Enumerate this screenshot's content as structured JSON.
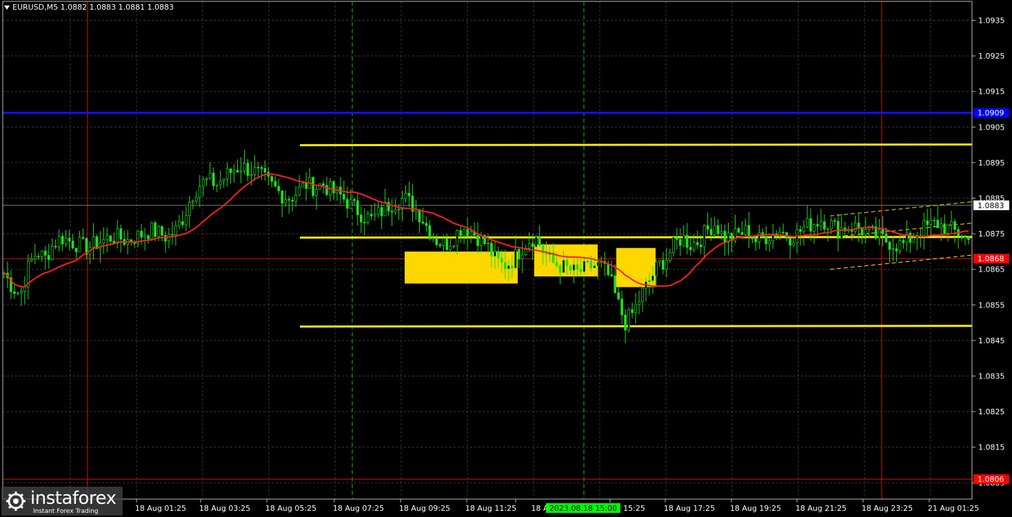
{
  "header": {
    "symbol_info": "EURUSD,M5  1.0882 1.0883 1.0881 1.0883"
  },
  "chart_data": {
    "type": "candlestick",
    "symbol": "EURUSD",
    "timeframe": "M5",
    "ohlc_last": {
      "open": 1.0882,
      "high": 1.0883,
      "low": 1.0881,
      "close": 1.0883
    },
    "ylim": [
      1.0801,
      1.0943
    ],
    "y_ticks": [
      "1.0935",
      "1.0925",
      "1.0915",
      "1.0905",
      "1.0895",
      "1.0885",
      "1.0875",
      "1.0865",
      "1.0855",
      "1.0845",
      "1.0835",
      "1.0825",
      "1.0815",
      "1.0805"
    ],
    "x_ticks": [
      "18 Aug 01:25",
      "18 Aug 03:25",
      "18 Aug 05:25",
      "18 Aug 07:25",
      "18 Aug 09:25",
      "18 Aug 11:25",
      "18 A",
      "15:25",
      "18 Aug 17:25",
      "18 Aug 19:25",
      "18 Aug 21:25",
      "18 Aug 23:25",
      "21 Aug 01:25"
    ],
    "x_highlight_label": "2023.08.18 15:00",
    "price_labels": [
      {
        "text": "1.0909",
        "color": "#0000ff"
      },
      {
        "text": "1.0883",
        "color": "#ffffff"
      },
      {
        "text": "1.0868",
        "color": "#ff0000"
      },
      {
        "text": "1.0806",
        "color": "#ff0000"
      }
    ],
    "levels": {
      "blue_line": 1.0909,
      "red_line_upper": 1.0868,
      "red_line_lower": 1.0806,
      "current_price": 1.0883,
      "yellow_channel": [
        1.09,
        1.0874,
        1.0849
      ]
    },
    "signal_zones": [
      {
        "top": 1.087,
        "bottom": 1.0861
      },
      {
        "top": 1.0872,
        "bottom": 1.0863
      },
      {
        "top": 1.0871,
        "bottom": 1.086
      }
    ],
    "series": [
      {
        "name": "Price",
        "close": [
          1.0864,
          1.086,
          1.0858,
          1.0866,
          1.087,
          1.0868,
          1.0872,
          1.0874,
          1.0873,
          1.0872,
          1.0871,
          1.0872,
          1.0873,
          1.0874,
          1.0874,
          1.0873,
          1.0874,
          1.0875,
          1.0876,
          1.0875,
          1.0874,
          1.0876,
          1.088,
          1.0886,
          1.0889,
          1.089,
          1.0889,
          1.0891,
          1.0893,
          1.0894,
          1.0893,
          1.0892,
          1.089,
          1.0888,
          1.0886,
          1.0885,
          1.0887,
          1.0889,
          1.0888,
          1.0889,
          1.0887,
          1.0886,
          1.0884,
          1.0882,
          1.088,
          1.0879,
          1.0881,
          1.0883,
          1.0884,
          1.0885,
          1.0883,
          1.088,
          1.0876,
          1.0873,
          1.0872,
          1.0874,
          1.0877,
          1.0876,
          1.0874,
          1.0872,
          1.0868,
          1.0866,
          1.0867,
          1.087,
          1.0873,
          1.0874,
          1.087,
          1.0867,
          1.0866,
          1.0865,
          1.0864,
          1.0865,
          1.0866,
          1.0866,
          1.0863,
          1.0856,
          1.085,
          1.0853,
          1.0858,
          1.0862,
          1.0866,
          1.0868,
          1.0872,
          1.0874,
          1.0872,
          1.0873,
          1.0876,
          1.0878,
          1.0874,
          1.0874,
          1.0875,
          1.0876,
          1.0873,
          1.0874,
          1.0875,
          1.0876,
          1.0874,
          1.0875,
          1.0877,
          1.0878,
          1.0879,
          1.0878,
          1.0876,
          1.0877,
          1.0877,
          1.0876,
          1.0875,
          1.0874,
          1.0873,
          1.0872,
          1.0872,
          1.0874,
          1.0876,
          1.0877,
          1.0878,
          1.0877,
          1.0876,
          1.0875,
          1.0873
        ]
      },
      {
        "name": "MA",
        "color": "#ff2020"
      }
    ],
    "grid": true
  },
  "watermark": {
    "brand": "instaforex",
    "tagline": "Instant Forex Trading"
  }
}
